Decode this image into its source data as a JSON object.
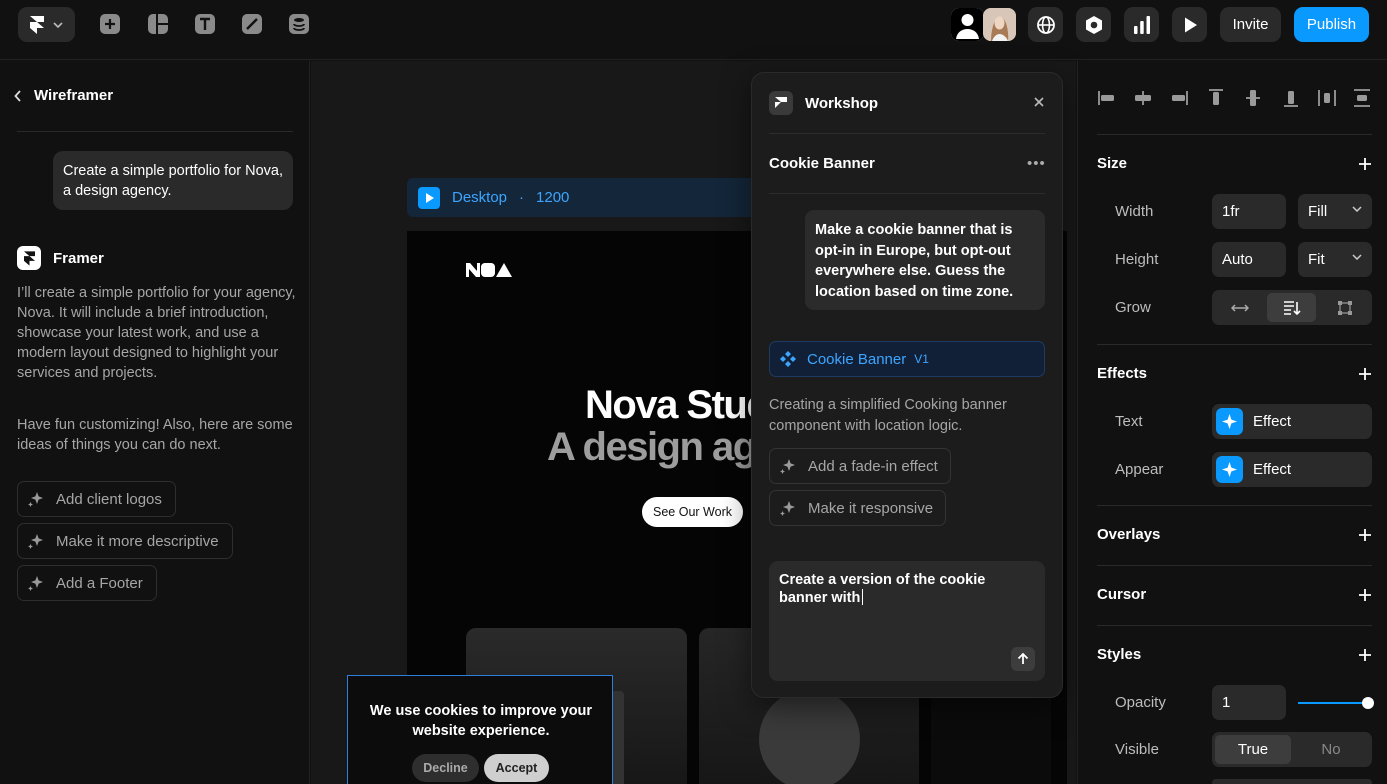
{
  "topbar": {
    "invite_label": "Invite",
    "publish_label": "Publish",
    "colors": {
      "accent": "#0a99ff"
    }
  },
  "left_panel": {
    "back_title": "Wireframer",
    "user_prompt": "Create a simple portfolio for Nova, a design agency.",
    "assistant_name": "Framer",
    "assistant_para1": "I’ll create a simple portfolio for your agency, Nova. It will include a brief introduction, showcase your latest work, and use a modern layout designed to highlight your services and projects.",
    "assistant_para2": "Have fun customizing! Also, here are some ideas of things you can do next.",
    "suggestions": [
      "Add client logos",
      "Make it more descriptive",
      "Add a Footer"
    ]
  },
  "canvas": {
    "frame_name": "Desktop",
    "frame_sep": "·",
    "frame_width": "1200",
    "site_logo": "NOA",
    "hero_line1": "Nova Studio",
    "hero_line2": "A design agency",
    "cta_label": "See Our Work",
    "cookie_text": "We use cookies to improve your website experience.",
    "cookie_decline": "Decline",
    "cookie_accept": "Accept"
  },
  "workshop": {
    "title": "Workshop",
    "component_title": "Cookie Banner",
    "user_message": "Make a cookie banner that is opt-in in Europe, but opt-out everywhere else. Guess the location based on time zone.",
    "component_name": "Cookie Banner",
    "component_version": "V1",
    "description": "Creating a simplified Cooking banner component with location logic.",
    "suggestions": [
      "Add a fade-in effect",
      "Make it responsive"
    ],
    "input_value": "Create a version of the cookie banner with"
  },
  "right_panel": {
    "size": {
      "title": "Size",
      "width_label": "Width",
      "width_value": "1fr",
      "width_mode": "Fill",
      "height_label": "Height",
      "height_value": "Auto",
      "height_mode": "Fit",
      "grow_label": "Grow"
    },
    "effects": {
      "title": "Effects",
      "text_label": "Text",
      "text_value": "Effect",
      "appear_label": "Appear",
      "appear_value": "Effect"
    },
    "overlays_title": "Overlays",
    "cursor_title": "Cursor",
    "styles": {
      "title": "Styles",
      "opacity_label": "Opacity",
      "opacity_value": "1",
      "opacity_slider": 1.0,
      "visible_label": "Visible",
      "visible_true": "True",
      "visible_false": "No"
    }
  }
}
